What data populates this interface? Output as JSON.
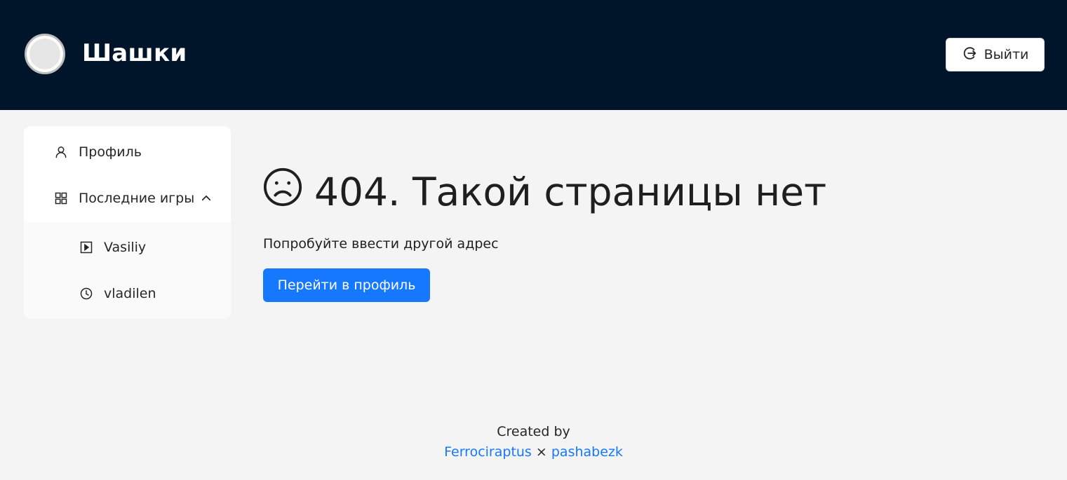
{
  "header": {
    "title": "Шашки",
    "logout_label": "Выйти",
    "logo_icon": "checker-piece-icon",
    "logout_icon": "logout-icon"
  },
  "sidebar": {
    "items": [
      {
        "label": "Профиль",
        "icon": "user-icon"
      },
      {
        "label": "Последние игры",
        "icon": "grid-icon",
        "expanded": true
      }
    ],
    "games": [
      {
        "label": "Vasiliy",
        "icon": "play-square-icon"
      },
      {
        "label": "vladilen",
        "icon": "clock-icon"
      }
    ]
  },
  "main": {
    "title": "404. Такой страницы нет",
    "subtitle": "Попробуйте ввести другой адрес",
    "button_label": "Перейти в профиль",
    "title_icon": "sad-face-icon"
  },
  "footer": {
    "created_by": "Created by",
    "author_1": "Ferrociraptus",
    "separator": "×",
    "author_2": "pashabezk"
  },
  "colors": {
    "header_bg": "#00152a",
    "page_bg": "#f4f4f4",
    "accent": "#1677ff"
  }
}
